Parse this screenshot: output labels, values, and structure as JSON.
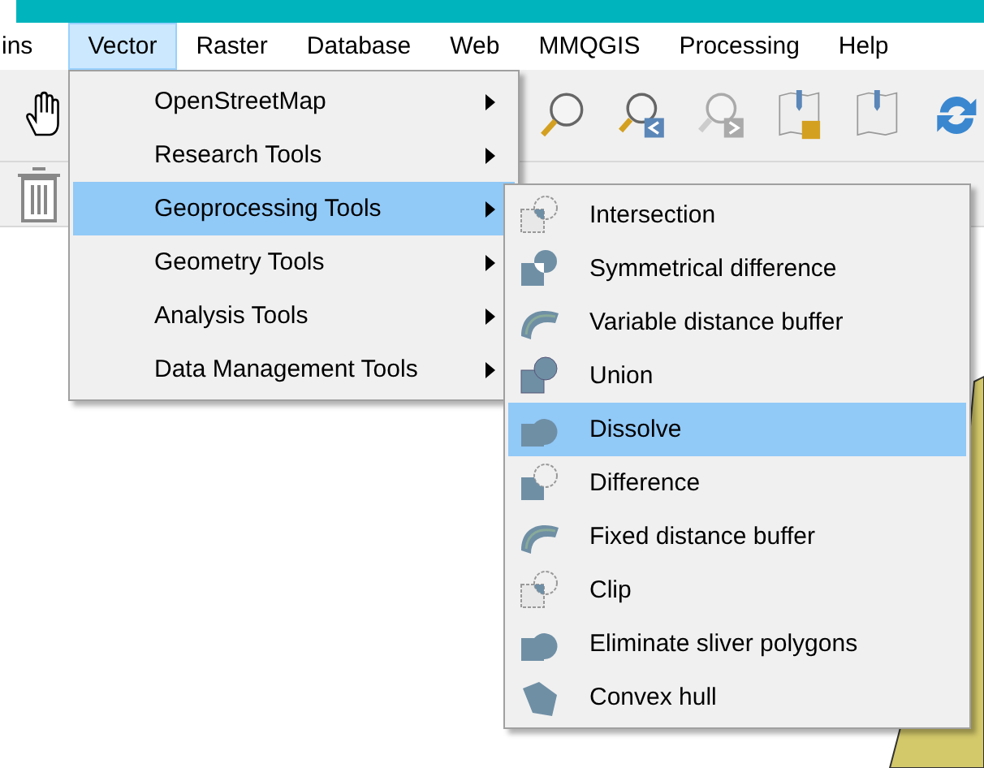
{
  "menubar": [
    {
      "label": "ins",
      "selected": false
    },
    {
      "label": "Vector",
      "selected": true
    },
    {
      "label": "Raster",
      "selected": false
    },
    {
      "label": "Database",
      "selected": false
    },
    {
      "label": "Web",
      "selected": false
    },
    {
      "label": "MMQGIS",
      "selected": false
    },
    {
      "label": "Processing",
      "selected": false
    },
    {
      "label": "Help",
      "selected": false
    }
  ],
  "vector_menu": [
    {
      "label": "OpenStreetMap",
      "selected": false
    },
    {
      "label": "Research Tools",
      "selected": false
    },
    {
      "label": "Geoprocessing Tools",
      "selected": true
    },
    {
      "label": "Geometry Tools",
      "selected": false
    },
    {
      "label": "Analysis Tools",
      "selected": false
    },
    {
      "label": "Data Management Tools",
      "selected": false
    }
  ],
  "geoprocessing_menu": [
    {
      "label": "Intersection",
      "selected": false,
      "kind": "intersection"
    },
    {
      "label": "Symmetrical difference",
      "selected": false,
      "kind": "symdiff"
    },
    {
      "label": "Variable distance buffer",
      "selected": false,
      "kind": "buffer"
    },
    {
      "label": "Union",
      "selected": false,
      "kind": "union"
    },
    {
      "label": "Dissolve",
      "selected": true,
      "kind": "dissolve"
    },
    {
      "label": "Difference",
      "selected": false,
      "kind": "difference"
    },
    {
      "label": "Fixed distance buffer",
      "selected": false,
      "kind": "buffer"
    },
    {
      "label": "Clip",
      "selected": false,
      "kind": "clip"
    },
    {
      "label": "Eliminate sliver polygons",
      "selected": false,
      "kind": "eliminate"
    },
    {
      "label": "Convex hull",
      "selected": false,
      "kind": "hull"
    }
  ]
}
